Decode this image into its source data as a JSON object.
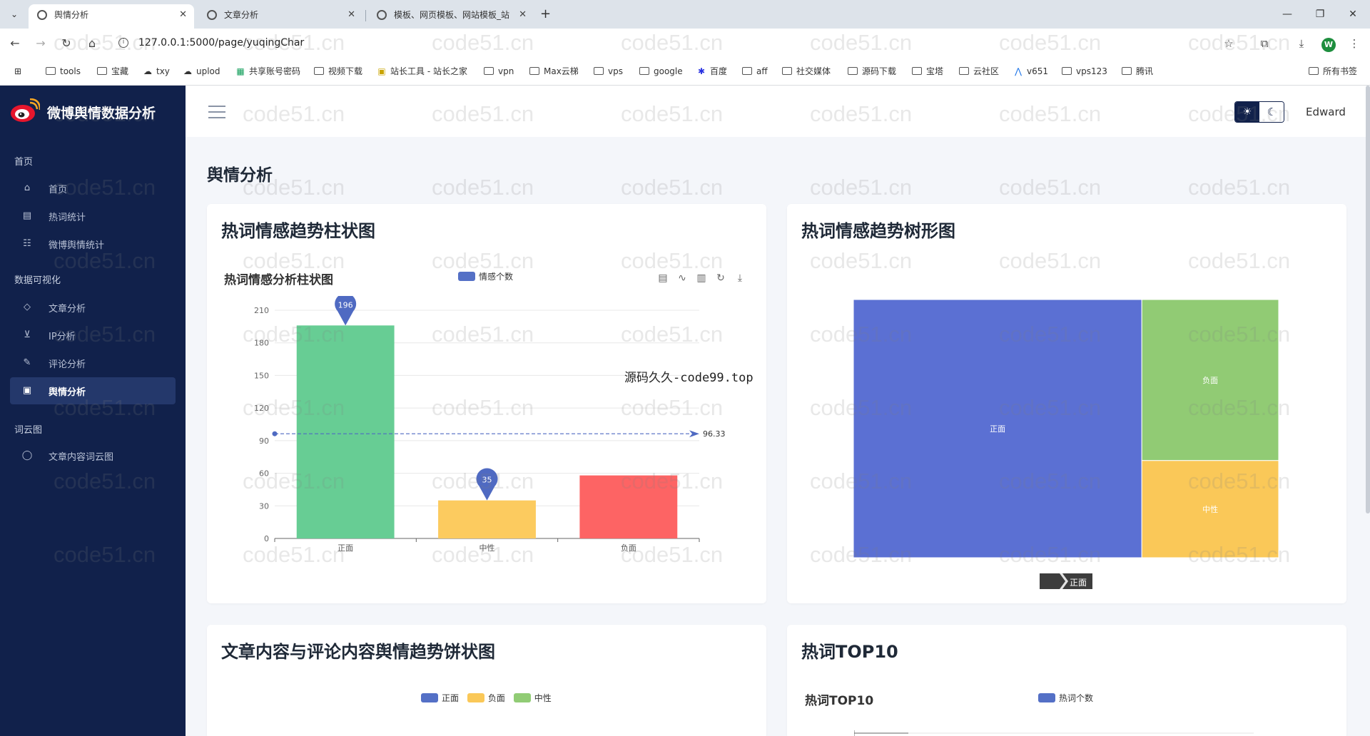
{
  "browser": {
    "tabs": [
      {
        "label": "舆情分析",
        "active": true
      },
      {
        "label": "文章分析",
        "active": false
      },
      {
        "label": "模板、网页模板、网站模板_站",
        "active": false
      }
    ],
    "new_tab": "+",
    "url": "127.0.0.1:5000/page/yuqingChar",
    "profile_initial": "W",
    "bookmarks": [
      "tools",
      "宝藏",
      "txy",
      "uplod",
      "共享账号密码",
      "视频下载",
      "站长工具 - 站长之家",
      "vpn",
      "Max云梯",
      "vps",
      "google",
      "百度",
      "aff",
      "社交媒体",
      "源码下载",
      "宝塔",
      "云社区",
      "v651",
      "vps123",
      "腾讯",
      "所有书签"
    ]
  },
  "sidebar": {
    "brand": "微博舆情数据分析",
    "sections": [
      {
        "title": "首页",
        "items": [
          {
            "label": "首页",
            "icon": "home-icon"
          },
          {
            "label": "热词统计",
            "icon": "table-icon"
          },
          {
            "label": "微博舆情统计",
            "icon": "users-icon"
          }
        ]
      },
      {
        "title": "数据可视化",
        "items": [
          {
            "label": "文章分析",
            "icon": "tag-icon"
          },
          {
            "label": "IP分析",
            "icon": "cart-icon"
          },
          {
            "label": "评论分析",
            "icon": "edit-icon"
          },
          {
            "label": "舆情分析",
            "icon": "clipboard-icon",
            "active": true
          }
        ]
      },
      {
        "title": "词云图",
        "items": [
          {
            "label": "文章内容词云图",
            "icon": "chat-icon"
          }
        ]
      }
    ]
  },
  "topbar": {
    "username": "Edward",
    "theme_light": "☀",
    "theme_dark": "☾"
  },
  "page_title": "舆情分析",
  "cards": {
    "bar": {
      "title": "热词情感趋势柱状图",
      "chart_title": "热词情感分析柱状图",
      "legend": "情感个数"
    },
    "treemap": {
      "title": "热词情感趋势树形图",
      "breadcrumb": "正面"
    },
    "pie": {
      "title": "文章内容与评论内容舆情趋势饼状图",
      "legend": [
        "正面",
        "负面",
        "中性"
      ]
    },
    "top10": {
      "title": "热词TOP10",
      "chart_title": "热词TOP10",
      "legend": "热词个数"
    }
  },
  "overlay_text": "源码久久-code99.top",
  "watermark_text": "code51.cn",
  "colors": {
    "positive": "#67cd94",
    "neutral": "#fccb5f",
    "negative": "#fd6464",
    "marker": "#4f6ac2",
    "treemap_pos": "#5b70d3",
    "treemap_neg": "#91cb74",
    "treemap_neu": "#fac858",
    "sidebar": "#11214b"
  },
  "chart_data": [
    {
      "type": "bar",
      "title": "热词情感分析柱状图",
      "categories": [
        "正面",
        "中性",
        "负面"
      ],
      "series": [
        {
          "name": "情感个数",
          "values": [
            196,
            35,
            58
          ]
        }
      ],
      "ylim": [
        0,
        210
      ],
      "yticks": [
        0,
        30,
        60,
        90,
        120,
        150,
        180,
        210
      ],
      "markpoints": [
        196,
        35
      ],
      "markline_average": 96.33,
      "markline_label": "96.33",
      "grid": true,
      "legend_position": "top-center"
    },
    {
      "type": "treemap",
      "title": "",
      "nodes": [
        {
          "name": "正面",
          "value": 196
        },
        {
          "name": "负面",
          "value": 58
        },
        {
          "name": "中性",
          "value": 35
        }
      ]
    }
  ]
}
